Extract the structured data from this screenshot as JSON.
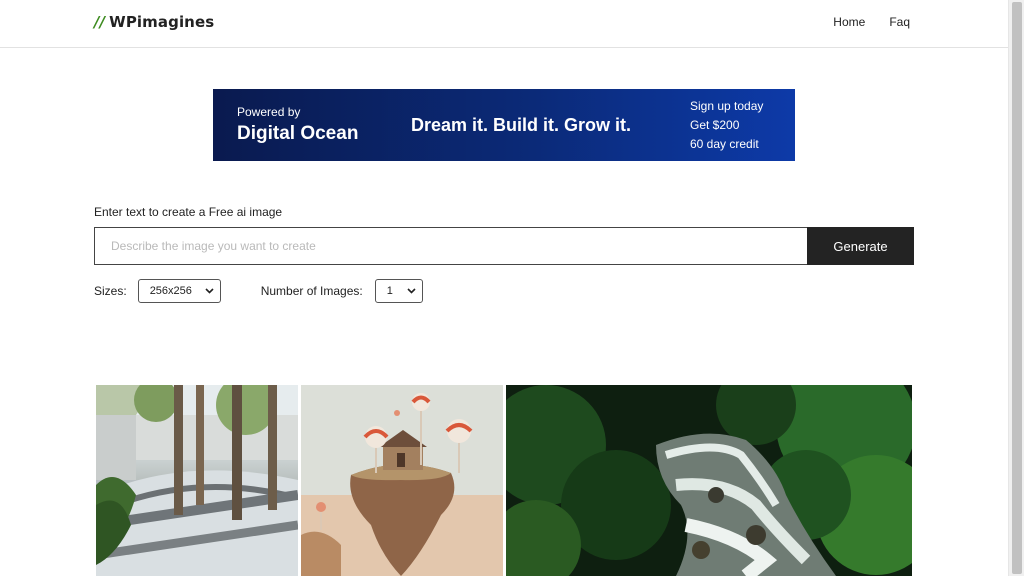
{
  "header": {
    "logo_mark": "//",
    "logo_text": "WPimagines",
    "nav": [
      {
        "label": "Home"
      },
      {
        "label": "Faq"
      }
    ]
  },
  "banner": {
    "powered_by": "Powered by",
    "brand": "Digital Ocean",
    "slogan": "Dream it. Build it. Grow it.",
    "offer_lines": [
      "Sign up today",
      "Get $200",
      "60 day credit"
    ]
  },
  "form": {
    "prompt_label": "Enter text to create a Free ai image",
    "prompt_placeholder": "Describe the image you want to create",
    "prompt_value": "",
    "generate_label": "Generate",
    "sizes_label": "Sizes:",
    "sizes_value": "256x256",
    "num_images_label": "Number of Images:",
    "num_images_value": "1"
  },
  "gallery": {
    "images": [
      {
        "name": "courtyard-trees-image"
      },
      {
        "name": "floating-island-lollipop-image"
      },
      {
        "name": "forest-waterfall-image"
      }
    ]
  },
  "colors": {
    "accent_green": "#3d8b1f",
    "banner_dark": "#0a1a4f",
    "banner_light": "#0d3aa8",
    "button_dark": "#232323"
  }
}
